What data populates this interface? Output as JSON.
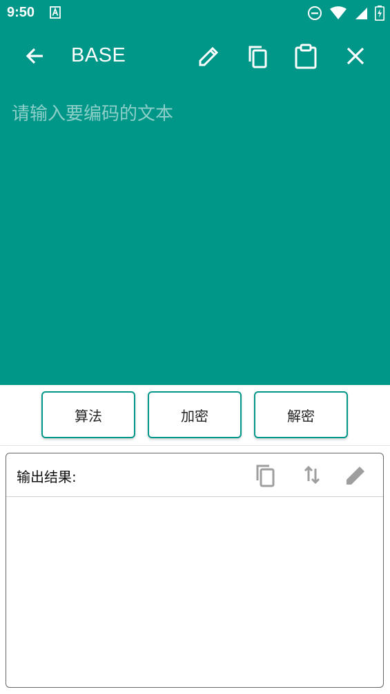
{
  "status_bar": {
    "time": "9:50",
    "icons": [
      "keyboard-a-icon",
      "do-not-disturb-icon",
      "wifi-icon",
      "signal-icon",
      "battery-charging-icon"
    ]
  },
  "toolbar": {
    "title": "BASE",
    "icons": [
      "back-arrow-icon",
      "pencil-icon",
      "copy-icon",
      "clipboard-icon",
      "close-icon"
    ]
  },
  "input": {
    "placeholder": "请输入要编码的文本",
    "value": ""
  },
  "actions": {
    "algorithm": "算法",
    "encrypt": "加密",
    "decrypt": "解密"
  },
  "output": {
    "label": "输出结果:",
    "value": "",
    "icons": [
      "copy-icon",
      "swap-vertical-icon",
      "pencil-icon"
    ]
  },
  "colors": {
    "primary": "#009688",
    "icon_gray": "#9e9e9e",
    "white": "#ffffff"
  }
}
